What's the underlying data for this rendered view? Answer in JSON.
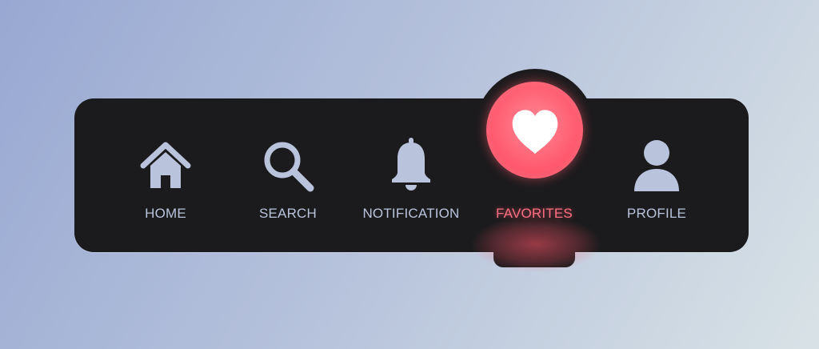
{
  "nav": {
    "items": [
      {
        "label": "HOME",
        "icon": "home-icon"
      },
      {
        "label": "SEARCH",
        "icon": "search-icon"
      },
      {
        "label": "NOTIFICATION",
        "icon": "bell-icon"
      },
      {
        "label": "FAVORITES",
        "icon": "heart-icon",
        "active": true
      },
      {
        "label": "PROFILE",
        "icon": "user-icon"
      }
    ],
    "colors": {
      "bar": "#1b1b1d",
      "inactive": "#b9c3dc",
      "accent": "#ff5a6e"
    }
  }
}
